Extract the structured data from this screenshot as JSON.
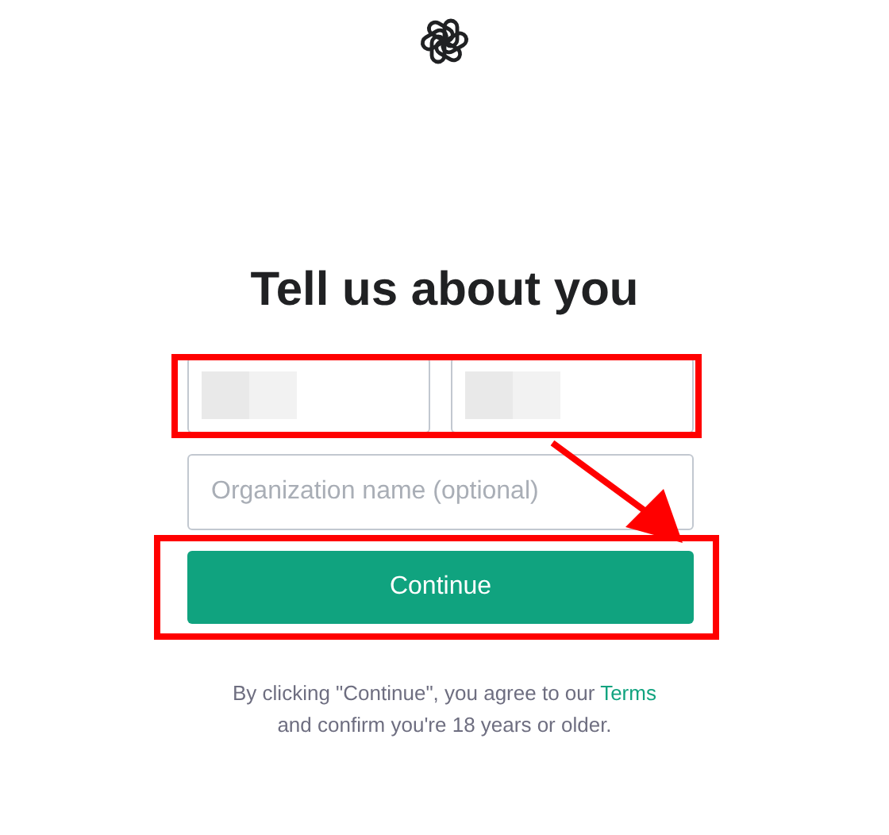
{
  "heading": "Tell us about you",
  "name_row": {
    "highlighted": true
  },
  "name_fields": [
    {
      "kind": "redacted"
    },
    {
      "kind": "redacted"
    }
  ],
  "organization_field": {
    "placeholder": "Organization name (optional)"
  },
  "continue_button": {
    "label": "Continue",
    "highlighted": true
  },
  "annotation_arrow": true,
  "legal": {
    "text": "By clicking \"Continue\", you agree to our",
    "link": "Terms",
    "text_2": "and confirm you're 18 years or older."
  }
}
